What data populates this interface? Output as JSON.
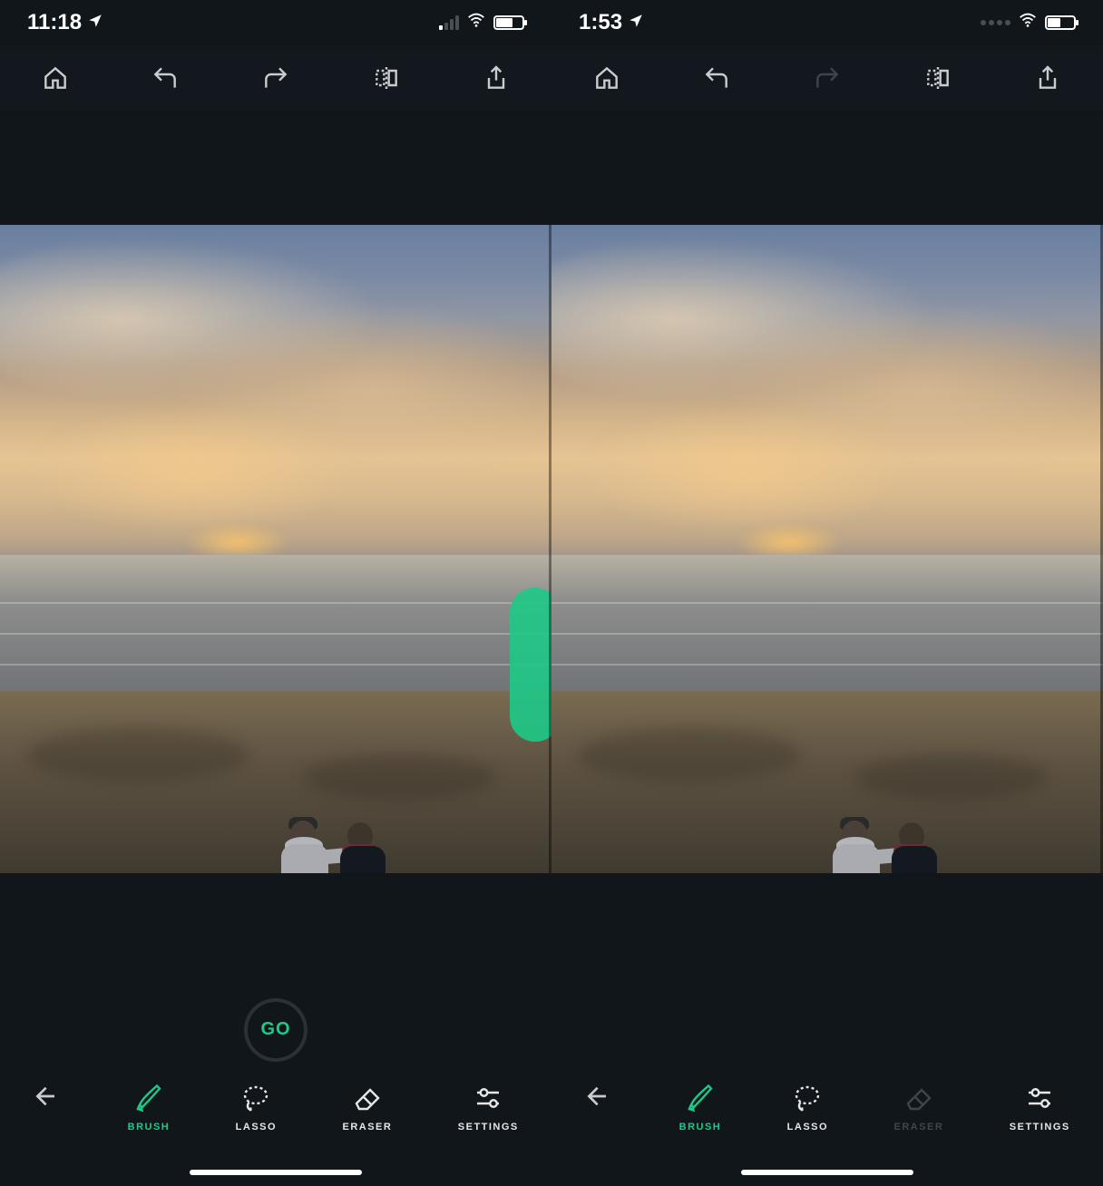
{
  "accent_color": "#1ec987",
  "screens": [
    {
      "status": {
        "time": "11:18",
        "signal_style": "bars",
        "battery_pct": 60,
        "redo_enabled": true
      },
      "go_label": "GO",
      "show_go": true,
      "show_brush_mark": true,
      "tools": {
        "brush": "BRUSH",
        "lasso": "LASSO",
        "eraser": "ERASER",
        "settings": "SETTINGS",
        "active": "brush",
        "eraser_dim": false
      }
    },
    {
      "status": {
        "time": "1:53",
        "signal_style": "dots",
        "battery_pct": 45,
        "redo_enabled": false
      },
      "go_label": "GO",
      "show_go": false,
      "show_brush_mark": false,
      "tools": {
        "brush": "BRUSH",
        "lasso": "LASSO",
        "eraser": "ERASER",
        "settings": "SETTINGS",
        "active": "brush",
        "eraser_dim": true
      }
    }
  ],
  "top_icons": [
    "home",
    "undo",
    "redo",
    "compare",
    "share"
  ]
}
